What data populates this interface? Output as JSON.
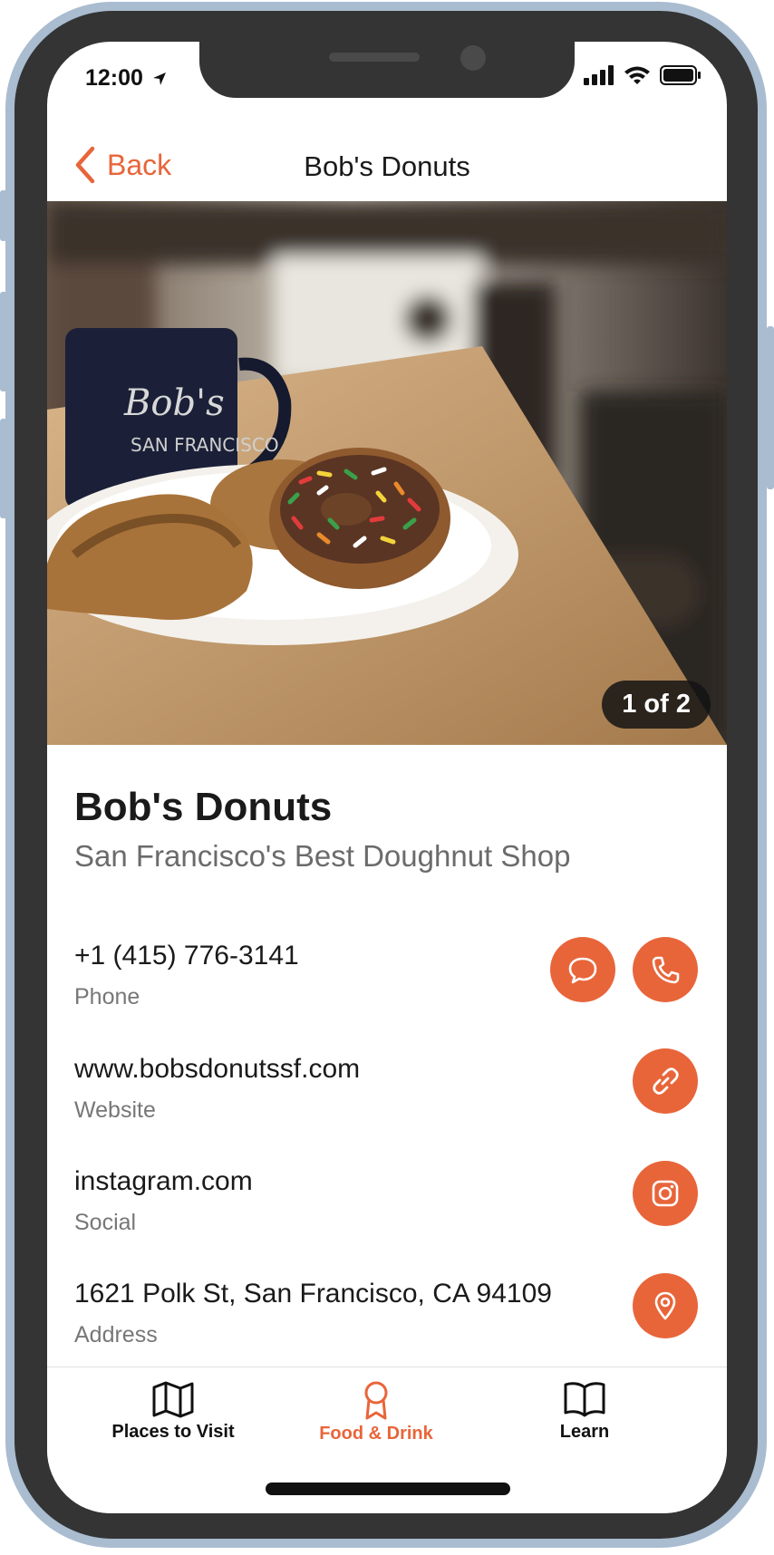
{
  "status_bar": {
    "time": "12:00"
  },
  "nav": {
    "back_label": "Back",
    "title": "Bob's Donuts"
  },
  "hero": {
    "counter": "1 of 2",
    "mug_text_1": "Bob's",
    "mug_text_2": "SAN FRANCISCO"
  },
  "place": {
    "name": "Bob's Donuts",
    "tagline": "San Francisco's Best Doughnut Shop"
  },
  "contacts": [
    {
      "value": "+1 (415) 776-3141",
      "label": "Phone",
      "actions": [
        "message-icon",
        "phone-icon"
      ]
    },
    {
      "value": "www.bobsdonutssf.com",
      "label": "Website",
      "actions": [
        "link-icon"
      ]
    },
    {
      "value": "instagram.com",
      "label": "Social",
      "actions": [
        "instagram-icon"
      ]
    },
    {
      "value": "1621 Polk St, San Francisco, CA 94109",
      "label": "Address",
      "actions": [
        "location-pin-icon"
      ]
    }
  ],
  "tabs": [
    {
      "label": "Places to Visit",
      "icon": "map-icon",
      "active": false
    },
    {
      "label": "Food & Drink",
      "icon": "award-ribbon-icon",
      "active": true
    },
    {
      "label": "Learn",
      "icon": "open-book-icon",
      "active": false
    }
  ],
  "colors": {
    "accent": "#e8653a",
    "frame": "#343434",
    "frame_edge": "#a9bcd0"
  }
}
